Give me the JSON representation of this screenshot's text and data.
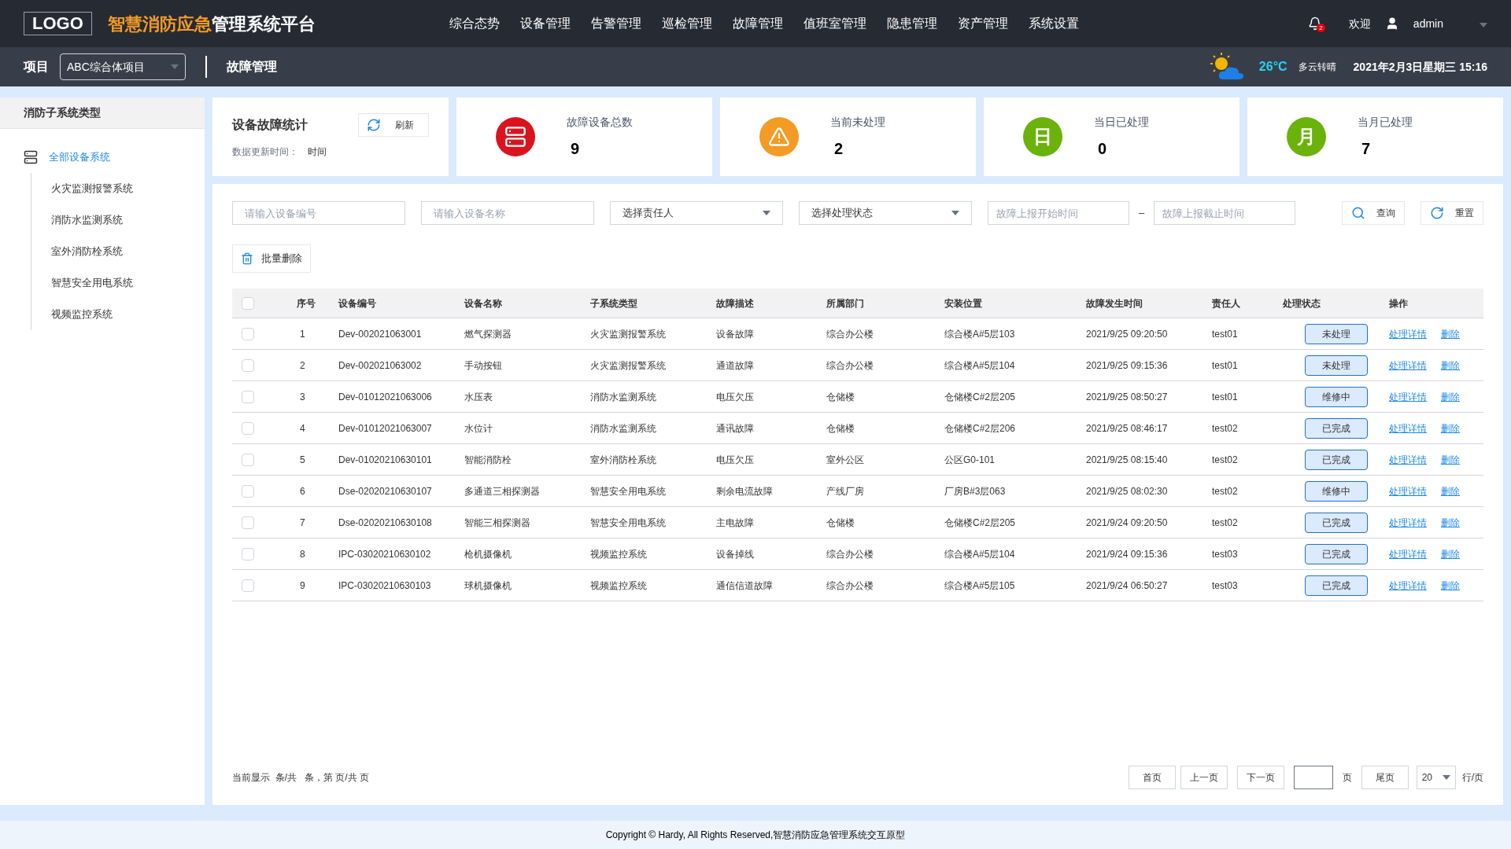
{
  "header": {
    "logo": "LOGO",
    "title_highlight": "智慧消防应急",
    "title_rest": "管理系统平台",
    "nav": [
      {
        "label": "综合态势",
        "selected": false
      },
      {
        "label": "设备管理",
        "selected": false
      },
      {
        "label": "告警管理",
        "selected": false
      },
      {
        "label": "巡检管理",
        "selected": false
      },
      {
        "label": "故障管理",
        "selected": false
      },
      {
        "label": "值班室管理",
        "selected": false
      },
      {
        "label": "隐患管理",
        "selected": false
      },
      {
        "label": "资产管理",
        "selected": false
      },
      {
        "label": "系统设置",
        "selected": false
      }
    ],
    "notification_count": "2",
    "welcome": "欢迎",
    "user": "admin"
  },
  "subheader": {
    "project_label": "项目",
    "project": "ABC综合体项目",
    "page_title": "故障管理",
    "temperature": "26°C",
    "weather": "多云转晴",
    "datetime": "2021年2月3日星期三 15:16"
  },
  "sidebar": {
    "title": "消防子系统类型",
    "items": [
      {
        "label": "全部设备系统",
        "selected": true,
        "children": [
          {
            "label": "火灾监测报警系统",
            "selected": false
          },
          {
            "label": "消防水监测系统",
            "selected": false
          },
          {
            "label": "室外消防栓系统",
            "selected": false
          },
          {
            "label": "智慧安全用电系统",
            "selected": false
          },
          {
            "label": "视频监控系统",
            "selected": false
          }
        ]
      }
    ]
  },
  "stats": {
    "title": "设备故障统计",
    "refresh": "刷新",
    "updated_label": "数据更新时间：",
    "updated_value": "时间",
    "cards": [
      {
        "kind": "server",
        "label": "故障设备总数",
        "value": "9",
        "color": "#d9141e"
      },
      {
        "kind": "warning",
        "label": "当前未处理",
        "value": "2",
        "color": "#f39b25"
      },
      {
        "kind": "text",
        "icon_text": "日",
        "label": "当日已处理",
        "value": "0",
        "color": "#6bb20b"
      },
      {
        "kind": "text",
        "icon_text": "月",
        "label": "当月已处理",
        "value": "7",
        "color": "#6bb20b"
      }
    ]
  },
  "filters": {
    "device_code": {
      "placeholder": "请输入设备编号"
    },
    "device_name": {
      "placeholder": "请输入设备名称"
    },
    "owner": {
      "value": "选择责任人"
    },
    "status": {
      "value": "选择处理状态"
    },
    "start_time": {
      "placeholder": "故障上报开始时间"
    },
    "separator": "–",
    "end_time": {
      "placeholder": "故障上报截止时间"
    },
    "search": "查询",
    "reset": "重置",
    "batch_delete": "批量删除"
  },
  "table": {
    "columns": [
      "序号",
      "设备编号",
      "设备名称",
      "子系统类型",
      "故障描述",
      "所属部门",
      "安装位置",
      "故障发生时间",
      "责任人",
      "处理状态",
      "操作"
    ],
    "all_checked": false,
    "rows": [
      {
        "checked": false,
        "cells": [
          "1",
          "Dev-002021063001",
          "燃气探测器",
          "火灾监测报警系统",
          "设备故障",
          "综合办公楼",
          "综合楼A#5层103",
          "2021/9/25 09:20:50",
          "test01"
        ],
        "status": "未处理",
        "actions": [
          "处理详情",
          "删除"
        ]
      },
      {
        "checked": false,
        "cells": [
          "2",
          "Dev-002021063002",
          "手动按钮",
          "火灾监测报警系统",
          "通道故障",
          "综合办公楼",
          "综合楼A#5层104",
          "2021/9/25 09:15:36",
          "test01"
        ],
        "status": "未处理",
        "actions": [
          "处理详情",
          "删除"
        ]
      },
      {
        "checked": false,
        "cells": [
          "3",
          "Dev-01012021063006",
          "水压表",
          "消防水监测系统",
          "电压欠压",
          "仓储楼",
          "仓储楼C#2层205",
          "2021/9/25 08:50:27",
          "test01"
        ],
        "status": "维修中",
        "actions": [
          "处理详情",
          "删除"
        ]
      },
      {
        "checked": false,
        "cells": [
          "4",
          "Dev-01012021063007",
          "水位计",
          "消防水监测系统",
          "通讯故障",
          "仓储楼",
          "仓储楼C#2层206",
          "2021/9/25 08:46:17",
          "test02"
        ],
        "status": "已完成",
        "actions": [
          "处理详情",
          "删除"
        ]
      },
      {
        "checked": false,
        "cells": [
          "5",
          "Dev-01020210630101",
          "智能消防栓",
          "室外消防栓系统",
          "电压欠压",
          "室外公区",
          "公区G0-101",
          "2021/9/25 08:15:40",
          "test02"
        ],
        "status": "已完成",
        "actions": [
          "处理详情",
          "删除"
        ]
      },
      {
        "checked": false,
        "cells": [
          "6",
          "Dse-02020210630107",
          "多通道三相探测器",
          "智慧安全用电系统",
          "剩余电流故障",
          "产线厂房",
          "厂房B#3层063",
          "2021/9/25 08:02:30",
          "test02"
        ],
        "status": "维修中",
        "actions": [
          "处理详情",
          "删除"
        ]
      },
      {
        "checked": false,
        "cells": [
          "7",
          "Dse-02020210630108",
          "智能三相探测器",
          "智慧安全用电系统",
          "主电故障",
          "仓储楼",
          "仓储楼C#2层205",
          "2021/9/24 09:20:50",
          "test02"
        ],
        "status": "已完成",
        "actions": [
          "处理详情",
          "删除"
        ]
      },
      {
        "checked": false,
        "cells": [
          "8",
          "IPC-03020210630102",
          "枪机摄像机",
          "视频监控系统",
          "设备掉线",
          "综合办公楼",
          "综合楼A#5层104",
          "2021/9/24 09:15:36",
          "test03"
        ],
        "status": "已完成",
        "actions": [
          "处理详情",
          "删除"
        ]
      },
      {
        "checked": false,
        "cells": [
          "9",
          "IPC-03020210630103",
          "球机摄像机",
          "视频监控系统",
          "通信信道故障",
          "综合办公楼",
          "综合楼A#5层105",
          "2021/9/24 06:50:27",
          "test03"
        ],
        "status": "已完成",
        "actions": [
          "处理详情",
          "删除"
        ]
      }
    ]
  },
  "pagination": {
    "summary": "当前显示  条/共   条，第 页/共 页",
    "first": "首页",
    "prev": "上一页",
    "next": "下一页",
    "page_unit": "页",
    "last": "尾页",
    "page_size": "20",
    "per_page": "行/页"
  },
  "footer": "Copyright © Hardy, All Rights Reserved,智慧消防应急管理系统交互原型"
}
